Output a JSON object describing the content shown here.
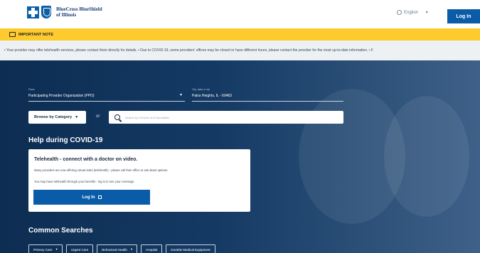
{
  "header": {
    "brand_line1": "BlueCross BlueShield",
    "brand_line2": "of Illinois",
    "language": "English",
    "login_label": "Log In"
  },
  "note": {
    "label": "IMPORTANT NOTE",
    "ticker": "• Your provider may offer telehealth services, please contact them directly for details. • Due to COVID-19, some providers' offices may be closed or have different hours, please contact the provider for the most up-to-date information. • F"
  },
  "search": {
    "plan_label": "Plans",
    "plan_value": "Participating Provider Organization (PPO)",
    "location_label": "City, state or zip",
    "location_value": "Palos Heights, IL - 60463",
    "browse_label": "Browse by Category",
    "or_text": "or",
    "placeholder": "Search by Provider and Specialties"
  },
  "covid": {
    "title": "Help during COVID-19",
    "card_title": "Telehealth - connect with a doctor on video.",
    "card_line1": "Many providers are now offering virtual visits (telehealth) - please call their office to ask about options.",
    "card_line2": "You may have telehealth through your benefits - log in to see your coverage.",
    "card_button": "Log In"
  },
  "common": {
    "title": "Common Searches",
    "chips": [
      {
        "label": "Primary Care",
        "has_dropdown": true
      },
      {
        "label": "Urgent Care",
        "has_dropdown": false
      },
      {
        "label": "Behavioral Health",
        "has_dropdown": true
      },
      {
        "label": "Hospital",
        "has_dropdown": false
      },
      {
        "label": "Durable Medical Equipment",
        "has_dropdown": false
      }
    ]
  },
  "icons": {
    "note": "speech-bubble-icon",
    "globe": "globe-icon",
    "search": "search-icon",
    "external": "external-link-icon"
  },
  "colors": {
    "brand_blue": "#0a5ba8",
    "note_yellow": "#fdcb2e",
    "hero_navy": "#0d2d52"
  }
}
